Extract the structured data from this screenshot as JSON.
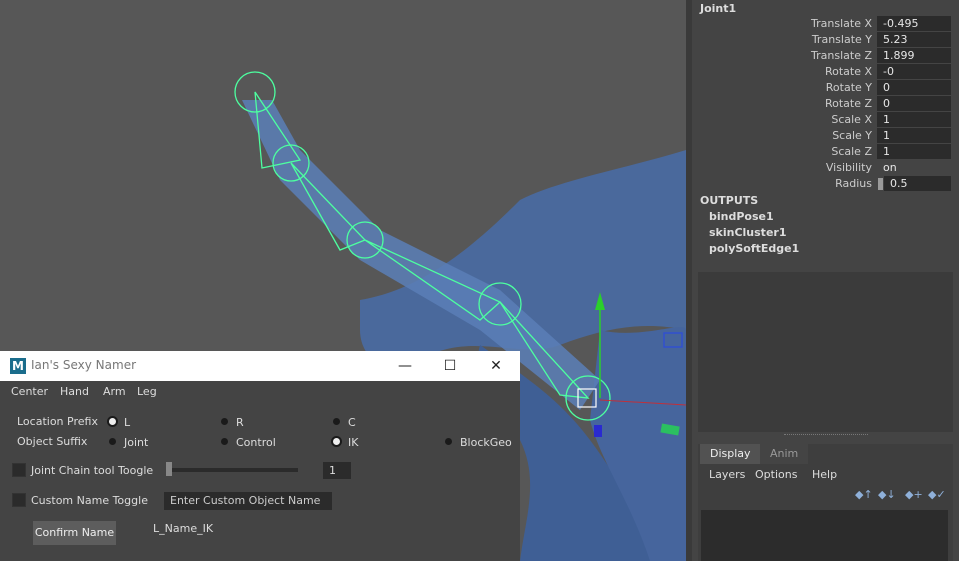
{
  "attributes": {
    "node_name": "Joint1",
    "rows": [
      {
        "label": "Translate X",
        "value": "-0.495"
      },
      {
        "label": "Translate Y",
        "value": "5.23"
      },
      {
        "label": "Translate Z",
        "value": "1.899"
      },
      {
        "label": "Rotate X",
        "value": "-0"
      },
      {
        "label": "Rotate Y",
        "value": "0"
      },
      {
        "label": "Rotate Z",
        "value": "0"
      },
      {
        "label": "Scale X",
        "value": "1"
      },
      {
        "label": "Scale Y",
        "value": "1"
      },
      {
        "label": "Scale Z",
        "value": "1"
      },
      {
        "label": "Visibility",
        "value": "on"
      },
      {
        "label": "Radius",
        "value": "0.5"
      }
    ],
    "outputs_header": "OUTPUTS",
    "outputs": [
      "bindPose1",
      "skinCluster1",
      "polySoftEdge1"
    ]
  },
  "layer_editor": {
    "tabs": [
      "Display",
      "Anim"
    ],
    "menu": [
      "Layers",
      "Options",
      "Help"
    ]
  },
  "namer": {
    "window_title": "Ian's Sexy Namer",
    "app_icon_letter": "M",
    "window_buttons": {
      "minimize": "—",
      "maximize": "☐",
      "close": "✕"
    },
    "menu": [
      "Center",
      "Hand",
      "Arm",
      "Leg"
    ],
    "location_prefix_label": "Location Prefix",
    "location_options": [
      "L",
      "R",
      "C"
    ],
    "location_selected": "L",
    "object_suffix_label": "Object Suffix",
    "suffix_options": [
      "Joint",
      "Control",
      "IK",
      "BlockGeo"
    ],
    "suffix_selected": "IK",
    "joint_chain_label": "Joint Chain tool Toogle",
    "joint_chain_value": "1",
    "custom_name_label": "Custom Name Toggle",
    "custom_name_placeholder": "Enter Custom Object Name",
    "confirm_label": "Confirm Name",
    "preview_name": "L_Name_IK"
  },
  "colors": {
    "joint_wire": "#4dffa0",
    "mesh": "#4a6aa0",
    "viewport_bg": "#575757"
  }
}
